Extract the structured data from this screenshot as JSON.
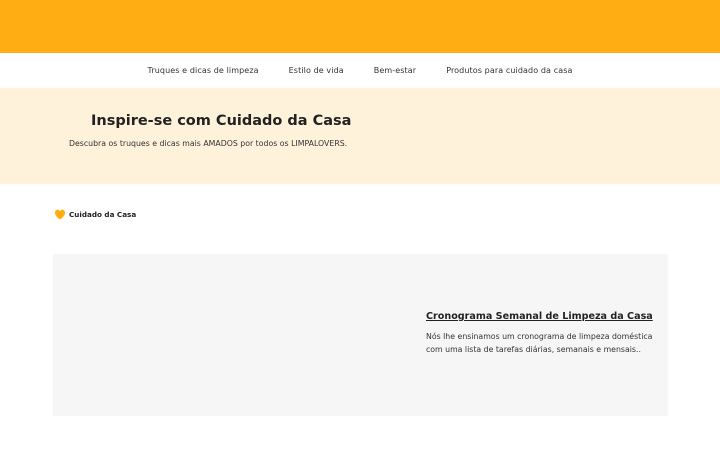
{
  "colors": {
    "accent": "#ffad12",
    "hero_bg": "#fff2db",
    "card_bg": "#f6f6f6"
  },
  "nav": {
    "items": [
      {
        "label": "Truques e dicas de limpeza"
      },
      {
        "label": "Estilo de vida"
      },
      {
        "label": "Bem-estar"
      },
      {
        "label": "Produtos para cuidado da casa"
      }
    ]
  },
  "hero": {
    "title": "Inspire-se com Cuidado da Casa",
    "subtitle": "Descubra os truques e dicas mais AMADOS por todos os LIMPALOVERS."
  },
  "category": {
    "icon": "heart-icon",
    "label": "Cuidado da Casa"
  },
  "article": {
    "title": "Cronograma Semanal de Limpeza da Casa",
    "description": "Nós lhe ensinamos um cronograma de limpeza doméstica com uma lista de tarefas diárias, semanais e mensais.."
  }
}
